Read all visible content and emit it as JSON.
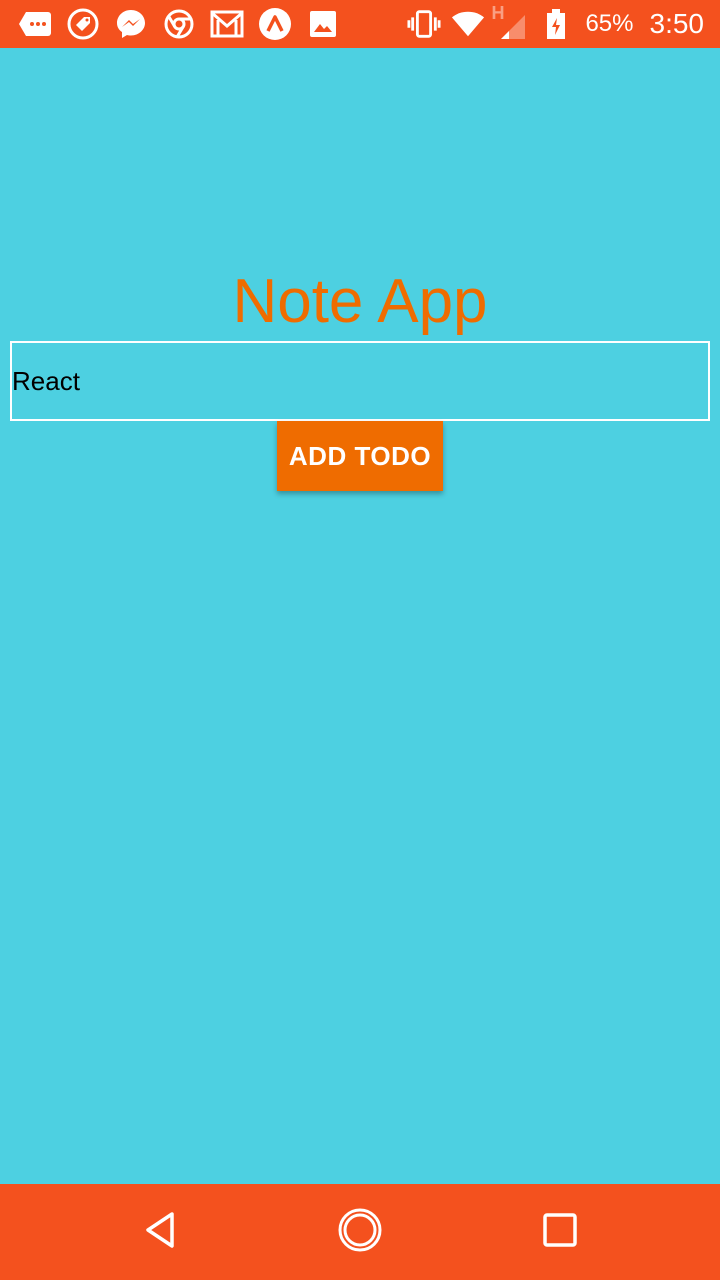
{
  "status_bar": {
    "battery_percent": "65%",
    "time": "3:50",
    "network_type": "H",
    "left_icons": [
      "chat-bubble-icon",
      "tag-icon",
      "messenger-icon",
      "chrome-icon",
      "gmail-icon",
      "arrow-app-icon",
      "image-icon"
    ],
    "right_icons": [
      "vibrate-icon",
      "wifi-icon",
      "cell-signal-icon",
      "battery-charging-icon"
    ]
  },
  "app": {
    "title": "Note App",
    "input_value": "React",
    "add_button_label": "ADD TODO"
  },
  "colors": {
    "background": "#4dd0e1",
    "status_bar": "#f4511e",
    "accent": "#ef6c00"
  },
  "nav_bar": {
    "buttons": [
      "back-icon",
      "home-icon",
      "recents-icon"
    ]
  }
}
